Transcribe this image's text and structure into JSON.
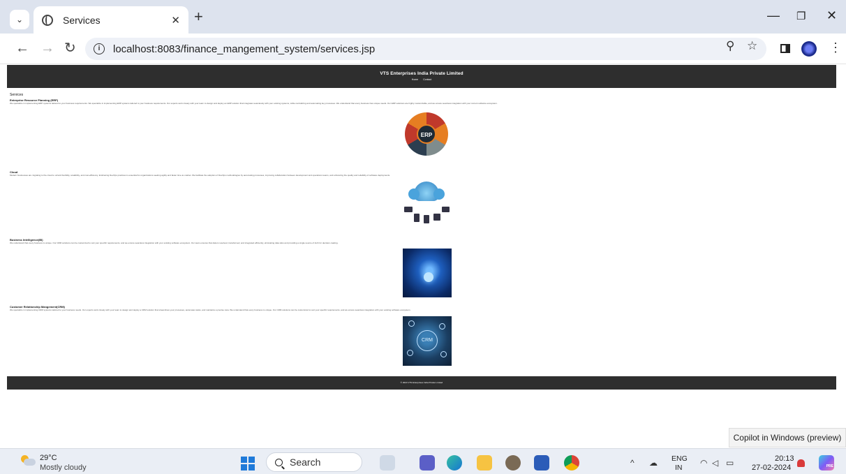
{
  "browser": {
    "tab_title": "Services",
    "url": "localhost:8083/finance_mangement_system/services.jsp"
  },
  "site": {
    "title": "VTS Enterprises India Private Limited",
    "nav": [
      "Home",
      "Contact"
    ],
    "page_heading": "Services",
    "services": [
      {
        "title": "Enterprise Resource Planning (ERP)",
        "description": "We specialize in implementing ERP systems tailored to your business requirements. We specialize in implementing ERP systems tailored to your business requirements. Our experts work closely with your team to design and deploy an ERP solution that integrates seamlessly with your existing systems, while centralizing and automating key processes. We understand that every business has unique needs. Our ERP solutions are highly customizable, and we ensure seamless integration with your current software ecosystem.",
        "image_label": "ERP"
      },
      {
        "title": "Cloud",
        "description": "Modern businesses are migrating to the cloud to unlock flexibility, scalability, and cost-efficiency. Embracing DevOps practices is essential for organizations seeking agility and faster time-to-market. We facilitate the adoption of DevOps methodologies by automating processes, improving collaboration between development and operations teams, and enhancing the quality and reliability of software deployments."
      },
      {
        "title": "Business Intelligence(BI)",
        "description": "We understand that every business is unique. Our CRM solutions can be customized to suit your specific requirements, and we ensure seamless integration with your existing software ecosystem. Our team ensures that data is resolved, transformed, and integrated efficiently, eliminating data silos and providing a single source of truth for decision-making."
      },
      {
        "title": "Customer Relationship Mangement(CRM)",
        "description": "We specialize in implementing CRM systems tailored to your business needs. Our experts work closely with your team to design and deploy a CRM solution that streamlines your processes, automates tasks, and maintains a precise view. We understand that every business is unique. Our CRM solutions can be customized to suit your specific requirements, and we ensure seamless integration with your existing software ecosystem.",
        "image_label": "CRM"
      }
    ],
    "footer": "© 2024 VTS Enterprises India Private Limited"
  },
  "toast": "Copilot in Windows (preview)",
  "taskbar": {
    "temperature": "29°C",
    "weather": "Mostly cloudy",
    "search_placeholder": "Search",
    "lang_top": "ENG",
    "lang_bottom": "IN",
    "time": "20:13",
    "date": "27-02-2024",
    "copilot_badge": "PRE"
  }
}
